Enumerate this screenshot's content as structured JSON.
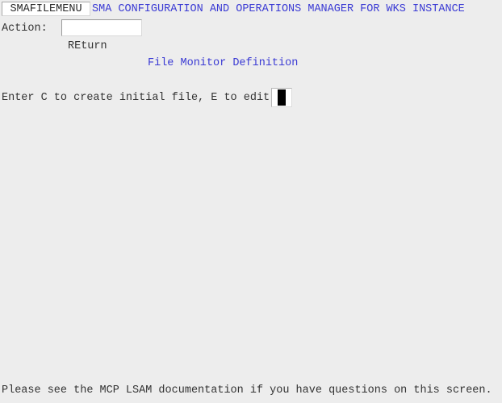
{
  "window": {
    "background_color": "#ededed",
    "text_color": "#333333",
    "accent_color": "#3b3bd4"
  },
  "header": {
    "screen_id": "SMAFILEMENU",
    "title": "SMA CONFIGURATION AND OPERATIONS MANAGER FOR WKS INSTANCE"
  },
  "action": {
    "label": "Action:",
    "value": "",
    "placeholder": "",
    "return_hint": "REturn"
  },
  "section": {
    "heading": "File Monitor Definition"
  },
  "prompt": {
    "text": "Enter C to create initial file, E to edit",
    "value": "",
    "cursor": "block-cursor"
  },
  "footer": {
    "note": "Please see the MCP LSAM documentation if you have questions on this screen."
  }
}
